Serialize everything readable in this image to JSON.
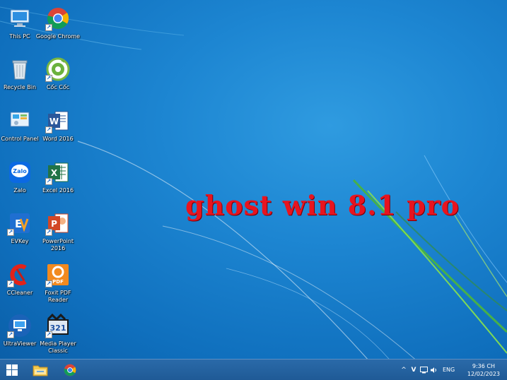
{
  "desktop": {
    "icons": [
      {
        "label": "This PC",
        "icon": "this-pc-icon"
      },
      {
        "label": "Google Chrome",
        "icon": "chrome-icon"
      },
      {
        "label": "Recycle Bin",
        "icon": "recycle-bin-icon"
      },
      {
        "label": "Cốc Cốc",
        "icon": "coc-coc-icon"
      },
      {
        "label": "Control Panel",
        "icon": "control-panel-icon"
      },
      {
        "label": "Word 2016",
        "icon": "word-icon"
      },
      {
        "label": "Zalo",
        "icon": "zalo-icon",
        "glyph_text": "Zalo"
      },
      {
        "label": "Excel 2016",
        "icon": "excel-icon"
      },
      {
        "label": "EVKey",
        "icon": "evkey-icon"
      },
      {
        "label": "PowerPoint 2016",
        "icon": "powerpoint-icon"
      },
      {
        "label": "CCleaner",
        "icon": "ccleaner-icon"
      },
      {
        "label": "Foxit PDF Reader",
        "icon": "foxit-icon",
        "glyph_text": "PDF"
      },
      {
        "label": "UltraViewer",
        "icon": "ultraviewer-icon"
      },
      {
        "label": "Media Player Classic",
        "icon": "media-player-classic-icon",
        "glyph_text": "321"
      }
    ],
    "headline": "ghost win 8.1 pro"
  },
  "taskbar": {
    "start_icon": "windows-start-icon",
    "pinned": [
      {
        "name": "file-explorer",
        "icon": "folder-icon"
      },
      {
        "name": "google-chrome",
        "icon": "chrome-icon"
      }
    ],
    "tray": {
      "chevron": "^",
      "vietkey": "V",
      "language": "ENG"
    },
    "clock": {
      "time": "9:36 CH",
      "date": "12/02/2023"
    }
  },
  "colors": {
    "accent_text": "#e8141f",
    "taskbar": "#1f5a96",
    "desktop": "#1d86d2"
  }
}
